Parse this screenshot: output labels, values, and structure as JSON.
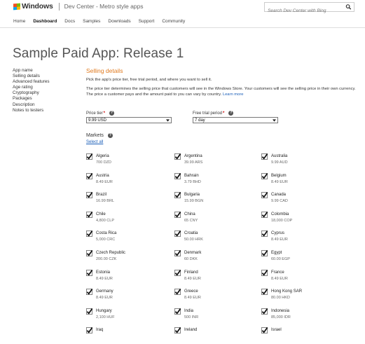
{
  "header": {
    "brand": "Windows",
    "subbrand": "Dev Center - Metro style apps",
    "search_placeholder": "Search Dev Center with Bing"
  },
  "nav": [
    {
      "label": "Home",
      "active": false
    },
    {
      "label": "Dashboard",
      "active": true
    },
    {
      "label": "Docs",
      "active": false
    },
    {
      "label": "Samples",
      "active": false
    },
    {
      "label": "Downloads",
      "active": false
    },
    {
      "label": "Support",
      "active": false
    },
    {
      "label": "Community",
      "active": false
    }
  ],
  "page_title": "Sample Paid App: Release 1",
  "leftnav": [
    "App name",
    "Selling details",
    "Advanced features",
    "Age rating",
    "Cryptography",
    "Packages",
    "Description",
    "Notes to testers"
  ],
  "selling": {
    "title": "Selling details",
    "intro": "Pick the app's price tier, free trial period, and where you want to sell it.",
    "desc": "The price tier determines the selling price that customers will see in the Windows Store. Your customers will see the selling price in their own currency. The price a customer pays and the amount paid to you can vary by country.",
    "learn_more": "Learn more",
    "price_tier_label": "Price tier",
    "price_tier_value": "9.99 USD",
    "trial_label": "Free trial period",
    "trial_value": "7 day",
    "required_mark": "*",
    "help_glyph": "?",
    "markets_label": "Markets",
    "select_all": "Select all"
  },
  "countries": [
    {
      "name": "Algeria",
      "price": "700 DZD",
      "checked": true
    },
    {
      "name": "Argentina",
      "price": "39.99 ARS",
      "checked": true
    },
    {
      "name": "Australia",
      "price": "9.99 AUD",
      "checked": true
    },
    {
      "name": "Austria",
      "price": "8.49 EUR",
      "checked": true
    },
    {
      "name": "Bahrain",
      "price": "3.79 BHD",
      "checked": true
    },
    {
      "name": "Belgium",
      "price": "8.49 EUR",
      "checked": true
    },
    {
      "name": "Brazil",
      "price": "16.99 BRL",
      "checked": true
    },
    {
      "name": "Bulgaria",
      "price": "15.99 BGN",
      "checked": true
    },
    {
      "name": "Canada",
      "price": "9.99 CAD",
      "checked": true
    },
    {
      "name": "Chile",
      "price": "4,800 CLP",
      "checked": true
    },
    {
      "name": "China",
      "price": "65 CNY",
      "checked": true
    },
    {
      "name": "Colombia",
      "price": "18,000 COP",
      "checked": true
    },
    {
      "name": "Costa Rica",
      "price": "5,000 CRC",
      "checked": true
    },
    {
      "name": "Croatia",
      "price": "50.00 HRK",
      "checked": true
    },
    {
      "name": "Cyprus",
      "price": "8.49 EUR",
      "checked": true
    },
    {
      "name": "Czech Republic",
      "price": "200.00 CZK",
      "checked": true
    },
    {
      "name": "Denmark",
      "price": "60 DKK",
      "checked": true
    },
    {
      "name": "Egypt",
      "price": "60.00 EGP",
      "checked": true
    },
    {
      "name": "Estonia",
      "price": "8.49 EUR",
      "checked": true
    },
    {
      "name": "Finland",
      "price": "8.49 EUR",
      "checked": true
    },
    {
      "name": "France",
      "price": "8.49 EUR",
      "checked": true
    },
    {
      "name": "Germany",
      "price": "8.49 EUR",
      "checked": true
    },
    {
      "name": "Greece",
      "price": "8.49 EUR",
      "checked": true
    },
    {
      "name": "Hong Kong SAR",
      "price": "80.00 HKD",
      "checked": true
    },
    {
      "name": "Hungary",
      "price": "2,100 HUF",
      "checked": true
    },
    {
      "name": "India",
      "price": "500 INR",
      "checked": true
    },
    {
      "name": "Indonesia",
      "price": "85,000 IDR",
      "checked": true
    },
    {
      "name": "Iraq",
      "price": "",
      "checked": true
    },
    {
      "name": "Ireland",
      "price": "",
      "checked": true
    },
    {
      "name": "Israel",
      "price": "",
      "checked": true
    }
  ]
}
